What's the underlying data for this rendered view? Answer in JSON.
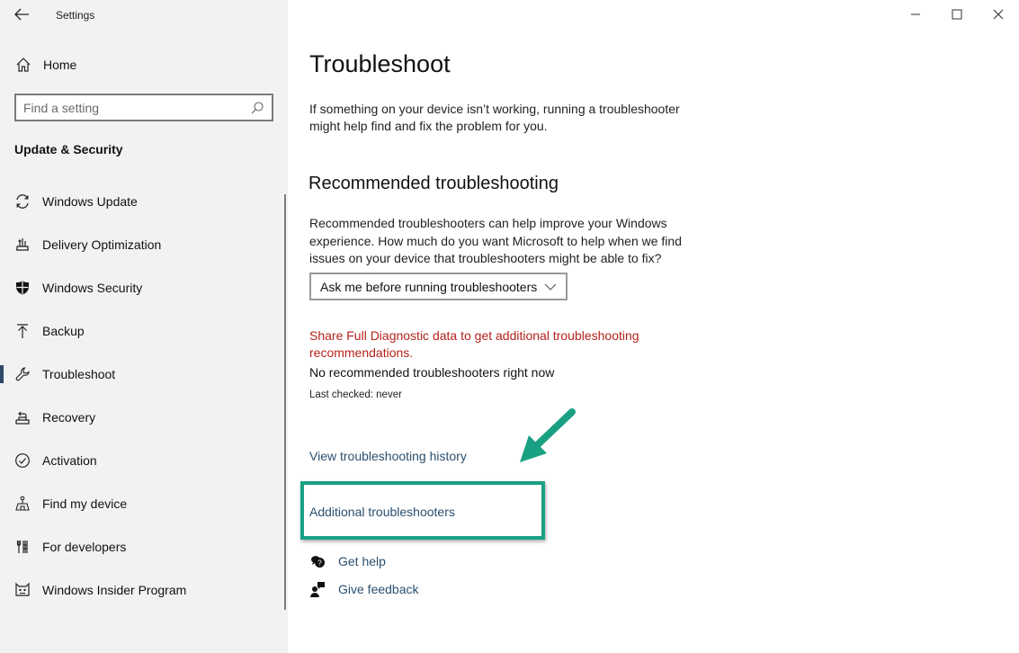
{
  "window": {
    "title": "Settings",
    "controls": {
      "minimize": "minimize-icon",
      "maximize": "maximize-icon",
      "close": "close-icon"
    }
  },
  "sidebar": {
    "back_icon": "back-arrow-icon",
    "home": {
      "label": "Home",
      "icon": "home-icon"
    },
    "search": {
      "placeholder": "Find a setting",
      "value": "",
      "icon": "search-icon"
    },
    "section_title": "Update & Security",
    "items": [
      {
        "label": "Windows Update",
        "icon": "sync-icon",
        "selected": false
      },
      {
        "label": "Delivery Optimization",
        "icon": "delivery-optimization-icon",
        "selected": false
      },
      {
        "label": "Windows Security",
        "icon": "shield-icon",
        "selected": false
      },
      {
        "label": "Backup",
        "icon": "upload-arrow-icon",
        "selected": false
      },
      {
        "label": "Troubleshoot",
        "icon": "wrench-icon",
        "selected": true
      },
      {
        "label": "Recovery",
        "icon": "recovery-icon",
        "selected": false
      },
      {
        "label": "Activation",
        "icon": "check-circle-icon",
        "selected": false
      },
      {
        "label": "Find my device",
        "icon": "find-device-icon",
        "selected": false
      },
      {
        "label": "For developers",
        "icon": "developer-tools-icon",
        "selected": false
      },
      {
        "label": "Windows Insider Program",
        "icon": "insider-cat-icon",
        "selected": false
      }
    ]
  },
  "main": {
    "title": "Troubleshoot",
    "description": "If something on your device isn’t working, running a troubleshooter might help find and fix the problem for you.",
    "recommended": {
      "heading": "Recommended troubleshooting",
      "description": "Recommended troubleshooters can help improve your Windows experience. How much do you want Microsoft to help when we find issues on your device that troubleshooters might be able to fix?",
      "dropdown_value": "Ask me before running troubleshooters",
      "diagnostic_link": "Share Full Diagnostic data to get additional troubleshooting recommendations.",
      "status": "No recommended troubleshooters right now",
      "last_checked": "Last checked: never"
    },
    "history_link": "View troubleshooting history",
    "additional_link": "Additional troubleshooters",
    "help_links": [
      {
        "label": "Get help",
        "icon": "get-help-icon"
      },
      {
        "label": "Give feedback",
        "icon": "give-feedback-icon"
      }
    ]
  },
  "annotation": {
    "highlight_color": "#1aa083",
    "arrow_color": "#1aa083"
  },
  "colors": {
    "sidebar_bg": "#f2f2f2",
    "accent_selected": "#2c4a68",
    "link": "#2b4f6f",
    "warning_link": "#b5221b"
  }
}
